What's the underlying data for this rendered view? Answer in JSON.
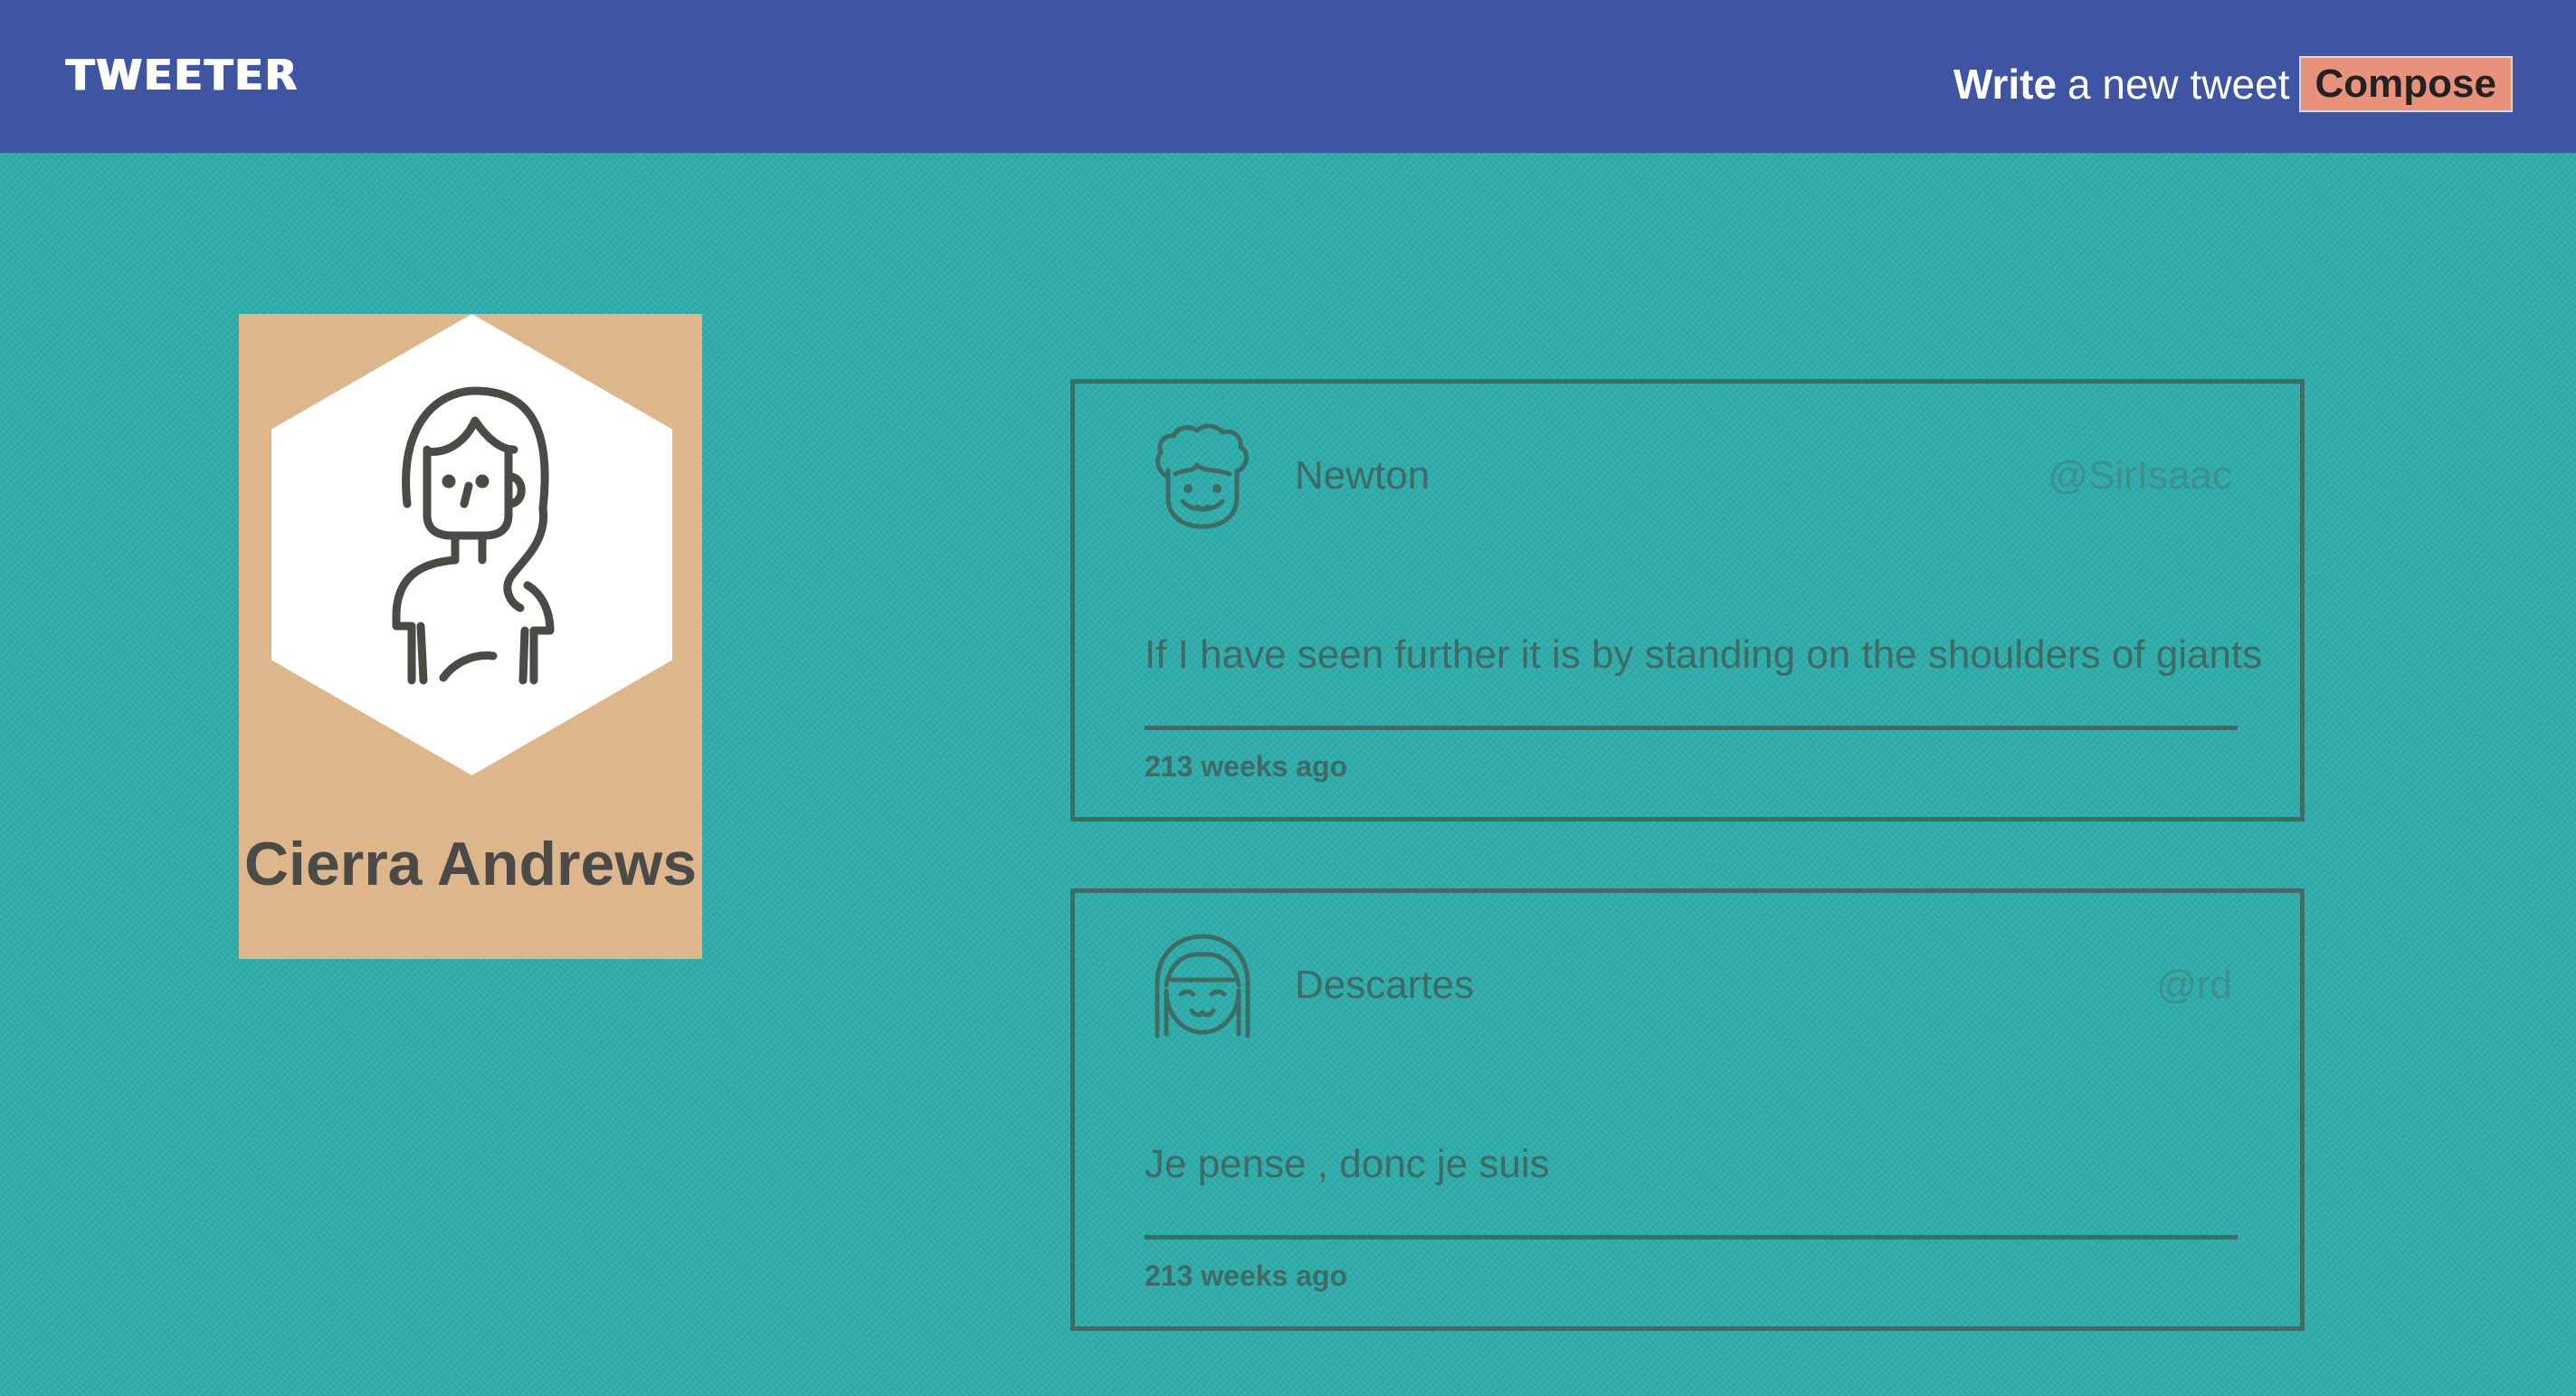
{
  "navbar": {
    "brand": "TWEETER",
    "write_bold": "Write",
    "write_rest": "a new tweet",
    "compose_label": "Compose",
    "bg_color": "#3f55a3",
    "compose_color": "#e8927c"
  },
  "profile": {
    "name": "Cierra Andrews",
    "avatar_icon": "woman-avatar-icon",
    "card_color": "#deb68b"
  },
  "page": {
    "bg_color": "#2eadab"
  },
  "tweets": [
    {
      "name": "Newton",
      "handle": "@SirIsaac",
      "text": "If I have seen further it is by standing on the shoulders of giants",
      "time": "213 weeks ago",
      "avatar_icon": "curly-hair-man-avatar-icon"
    },
    {
      "name": "Descartes",
      "handle": "@rd",
      "text": "Je pense , donc je suis",
      "time": "213 weeks ago",
      "avatar_icon": "bangs-face-avatar-icon"
    }
  ]
}
